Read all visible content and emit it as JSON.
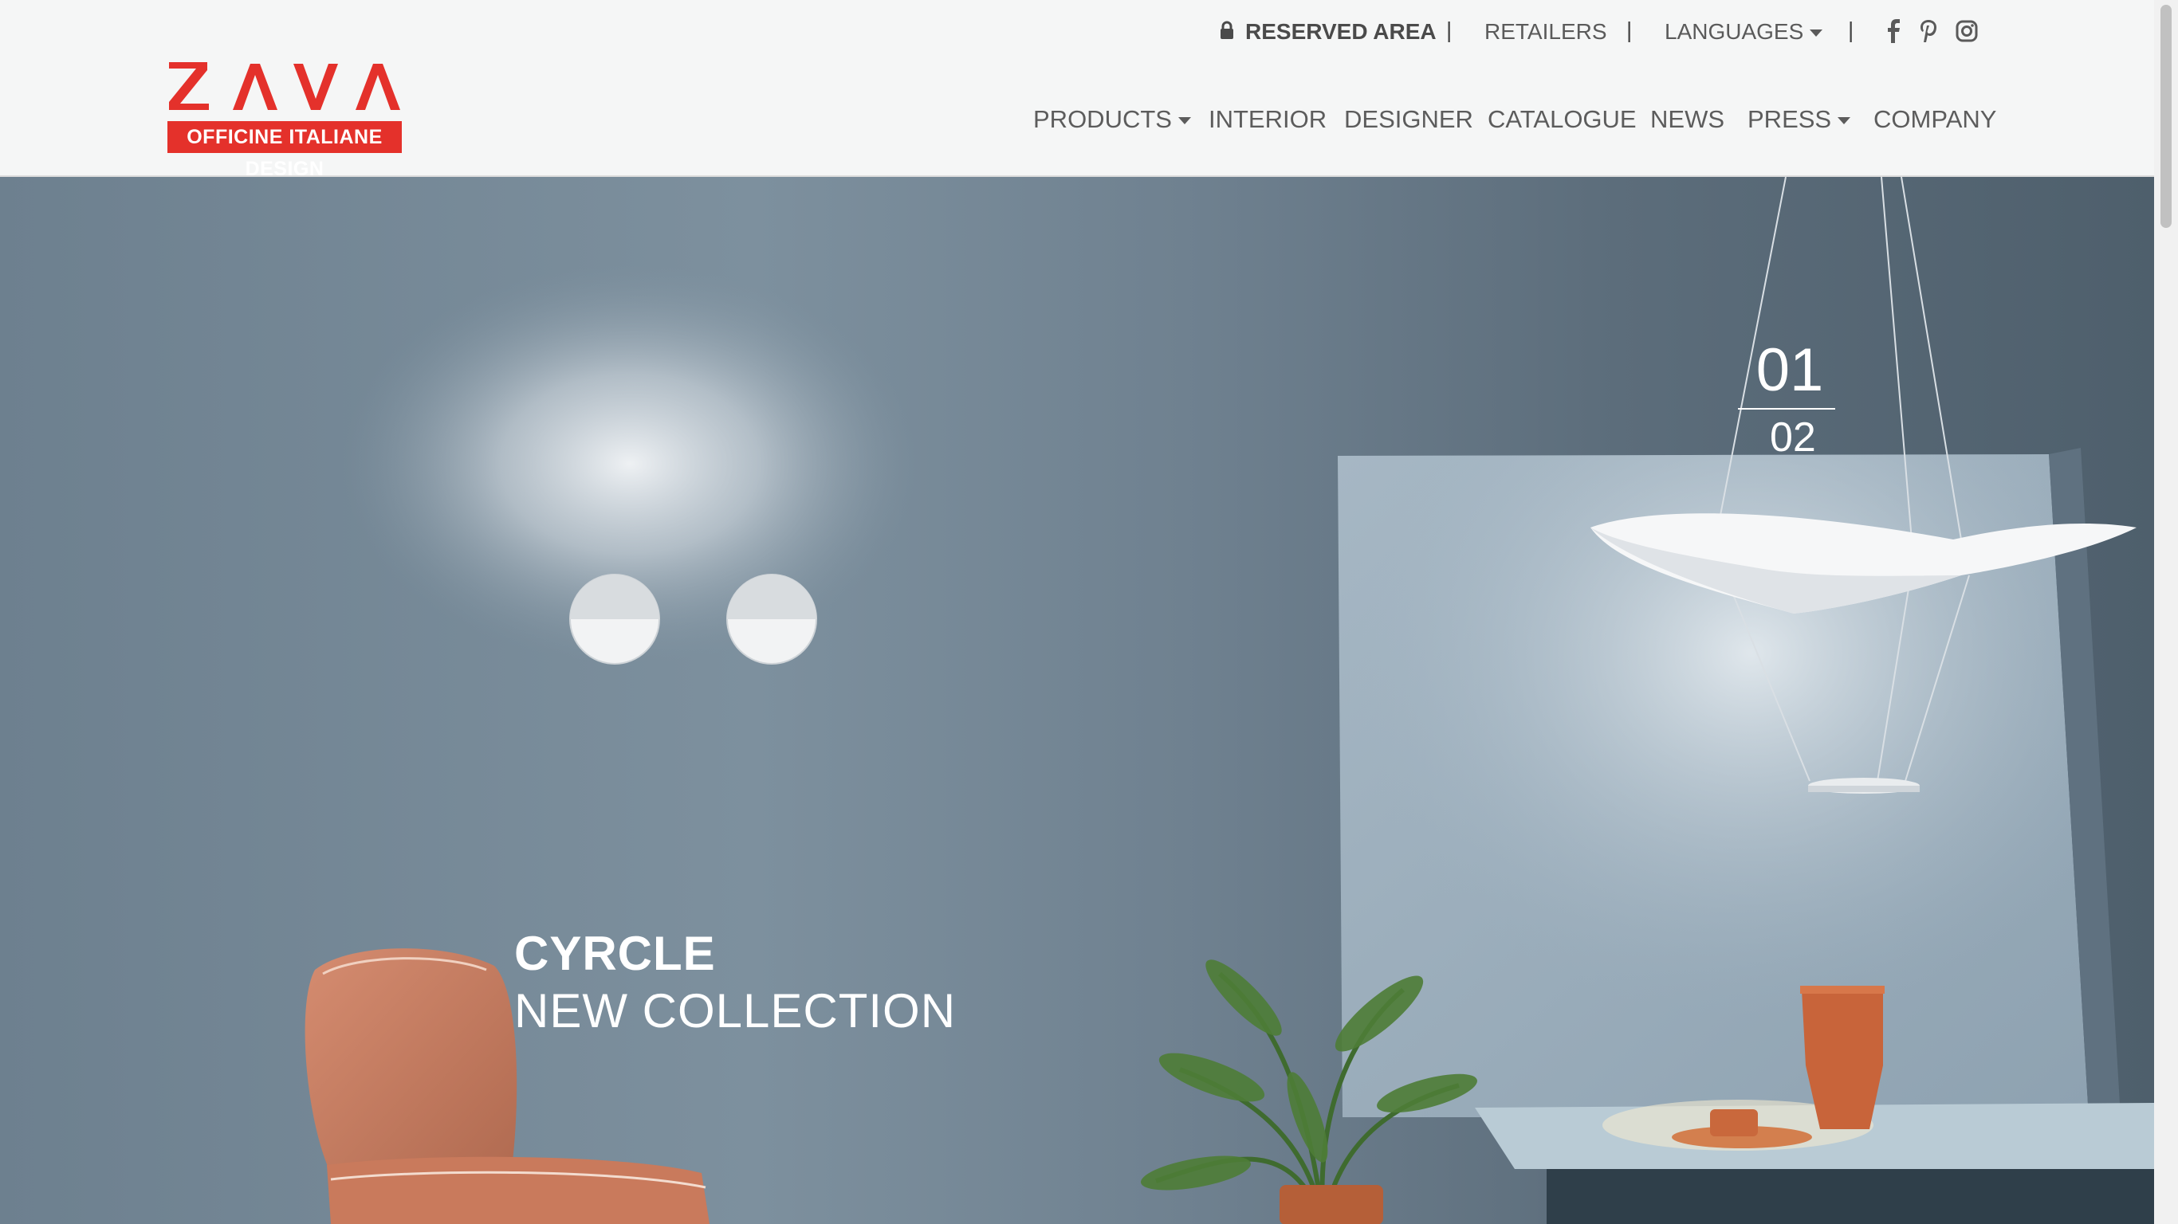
{
  "brand": {
    "logo_word": "ZAVA",
    "tagline": "OFFICINE ITALIANE DESIGN",
    "colors": {
      "red": "#e4312b",
      "header_bg": "#f5f6f6",
      "nav_text": "#5c5c5c"
    }
  },
  "topbar": {
    "reserved_area": "RESERVED AREA",
    "retailers": "RETAILERS",
    "languages": "LANGUAGES",
    "separator": "|",
    "social_icons": [
      "facebook-icon",
      "pinterest-icon",
      "instagram-icon"
    ]
  },
  "nav": {
    "products": "PRODUCTS",
    "interior": "INTERIOR",
    "designer": "DESIGNER",
    "catalogue": "CATALOGUE",
    "news": "NEWS",
    "press": "PRESS",
    "company": "COMPANY"
  },
  "hero": {
    "title": "CYRCLE",
    "subtitle": "NEW COLLECTION",
    "slide_current": "01",
    "slide_total": "02"
  }
}
